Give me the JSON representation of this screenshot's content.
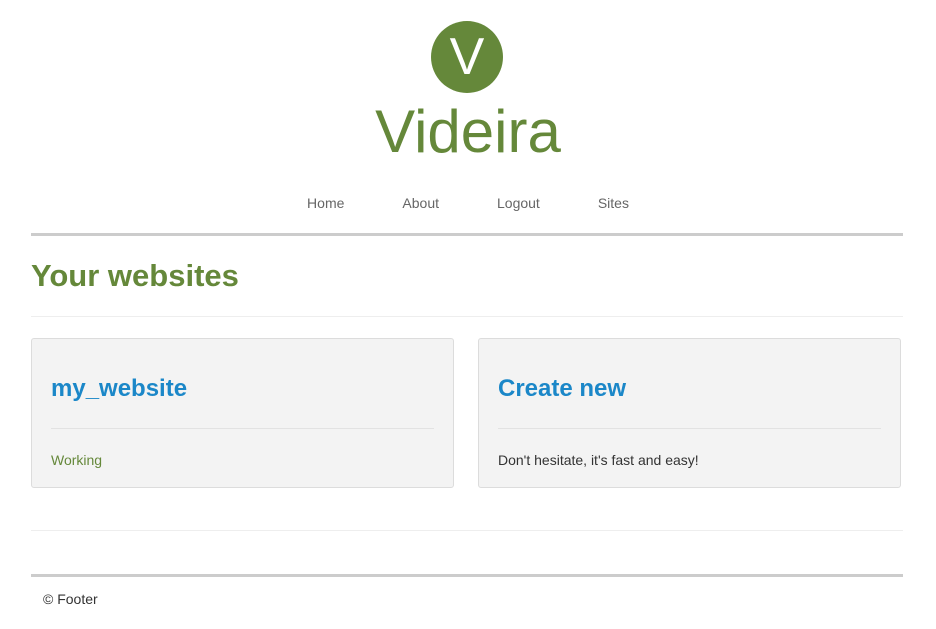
{
  "brand": {
    "logo_letter": "V",
    "title": "Videira",
    "accent_color": "#65883a"
  },
  "nav": {
    "items": [
      {
        "label": "Home"
      },
      {
        "label": "About"
      },
      {
        "label": "Logout"
      },
      {
        "label": "Sites"
      }
    ]
  },
  "main": {
    "heading": "Your websites",
    "cards": [
      {
        "title": "my_website",
        "status": "Working"
      },
      {
        "title": "Create new",
        "description": "Don't hesitate, it's fast and easy!"
      }
    ],
    "link_color": "#1b87c8"
  },
  "footer": {
    "text": "© Footer"
  }
}
